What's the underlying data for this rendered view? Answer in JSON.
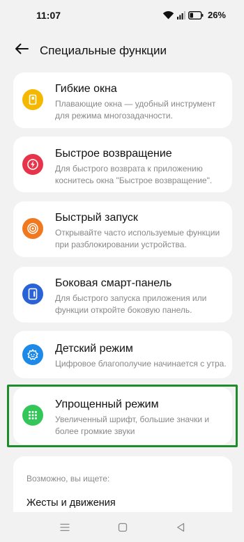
{
  "status_bar": {
    "time": "11:07",
    "battery": "26%"
  },
  "header": {
    "title": "Специальные функции"
  },
  "cards": [
    {
      "icon": "flexible-windows-icon",
      "icon_color": "#f5b800",
      "title": "Гибкие окна",
      "description": "Плавающие окна — удобный инструмент для режима многозадачности."
    },
    {
      "icon": "quick-return-icon",
      "icon_color": "#e8344a",
      "title": "Быстрое возвращение",
      "description": "Для быстрого возврата к приложению коснитесь окна \"Быстрое возвращение\"."
    },
    {
      "icon": "quick-launch-icon",
      "icon_color": "#f0781e",
      "title": "Быстрый запуск",
      "description": "Открывайте часто используемые функции при разблокировании устройства."
    },
    {
      "icon": "smart-sidebar-icon",
      "icon_color": "#2a62d8",
      "title": "Боковая смарт-панель",
      "description": "Для быстрого запуска приложения или функции откройте боковую панель."
    },
    {
      "icon": "kids-mode-icon",
      "icon_color": "#1e8ae8",
      "title": "Детский режим",
      "description": "Цифровое благополучие начинается с утра."
    },
    {
      "icon": "simple-mode-icon",
      "icon_color": "#33c75a",
      "title": "Упрощенный режим",
      "description": "Увеличенный шрифт, большие значки и более громкие звуки"
    }
  ],
  "suggestions": {
    "label": "Возможно, вы ищете:",
    "items": [
      "Жесты и движения"
    ]
  },
  "highlight_color": "#1f8b2b"
}
